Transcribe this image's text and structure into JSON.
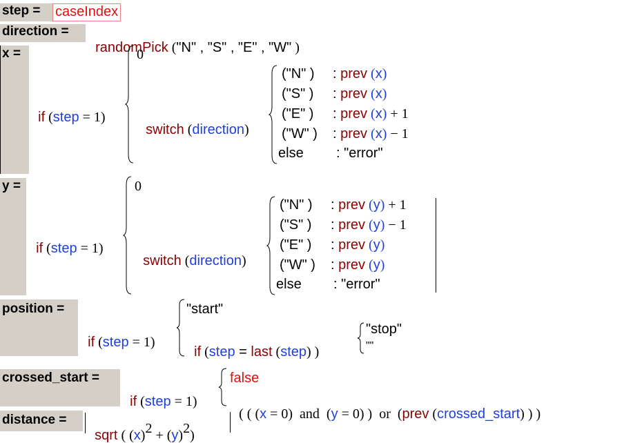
{
  "defs": {
    "step": {
      "label": "step =",
      "expr": "caseIndex"
    },
    "direction": {
      "label": "direction =",
      "fn": "randomPick",
      "open": " (",
      "args": "\"N\" , \"S\" , \"E\" , \"W\"",
      "close": " )"
    },
    "x": {
      "label": "x =",
      "base": "0",
      "if_kw": "if",
      "if_open": " (",
      "if_var": "step",
      "if_rest": " = 1)",
      "switch_kw": "switch",
      "switch_open": " (",
      "switch_var": "direction",
      "switch_close": ")",
      "cases": [
        {
          "key": "(\"N\" )",
          "fn": "prev",
          "var": "x",
          "suffix": ""
        },
        {
          "key": "(\"S\" )",
          "fn": "prev",
          "var": "x",
          "suffix": ""
        },
        {
          "key": "(\"E\" )",
          "fn": "prev",
          "var": "x",
          "suffix": " + 1"
        },
        {
          "key": "(\"W\" )",
          "fn": "prev",
          "var": "x",
          "suffix": " − 1"
        }
      ],
      "else_kw": "else",
      "else_val": ": \"error\""
    },
    "y": {
      "label": "y =",
      "base": "0",
      "if_kw": "if",
      "if_open": " (",
      "if_var": "step",
      "if_rest": " = 1)",
      "switch_kw": "switch",
      "switch_open": " (",
      "switch_var": "direction",
      "switch_close": ")",
      "cases": [
        {
          "key": "(\"N\" )",
          "fn": "prev",
          "var": "y",
          "suffix": " + 1"
        },
        {
          "key": "(\"S\" )",
          "fn": "prev",
          "var": "y",
          "suffix": " − 1"
        },
        {
          "key": "(\"E\" )",
          "fn": "prev",
          "var": "y",
          "suffix": ""
        },
        {
          "key": "(\"W\" )",
          "fn": "prev",
          "var": "y",
          "suffix": ""
        }
      ],
      "else_kw": "else",
      "else_val": ": \"error\""
    },
    "position": {
      "label": "position =",
      "if_kw": "if",
      "if_open": " (",
      "if_var": "step",
      "if_rest": " = 1)",
      "first": "\"start\"",
      "inner_if_kw": "if",
      "inner_open": " (",
      "inner_var": "step",
      "inner_eq": " = ",
      "inner_fn": "last",
      "inner_open2": " (",
      "inner_var2": "step",
      "inner_close": ") )",
      "stop": "\"stop\"",
      "empty": "\"\""
    },
    "crossed_start": {
      "label": "crossed_start =",
      "if_kw": "if",
      "if_open": " (",
      "if_var": "step",
      "if_rest": " = 1)",
      "first": "false",
      "p1": "( ( (",
      "v1": "x",
      "p2": " = 0)  and  (",
      "v2": "y",
      "p3": " = 0) )  or  (",
      "fn": "prev",
      "p4": " (",
      "v3": "crossed_start",
      "p5": ") ) )"
    },
    "distance": {
      "label": "distance =",
      "fn": "sqrt",
      "p1": " ( (",
      "v1": "x",
      "p2": ")",
      "exp1": "2",
      "p3": " + (",
      "v2": "y",
      "p4": ")",
      "exp2": "2",
      "p5": ")"
    }
  }
}
